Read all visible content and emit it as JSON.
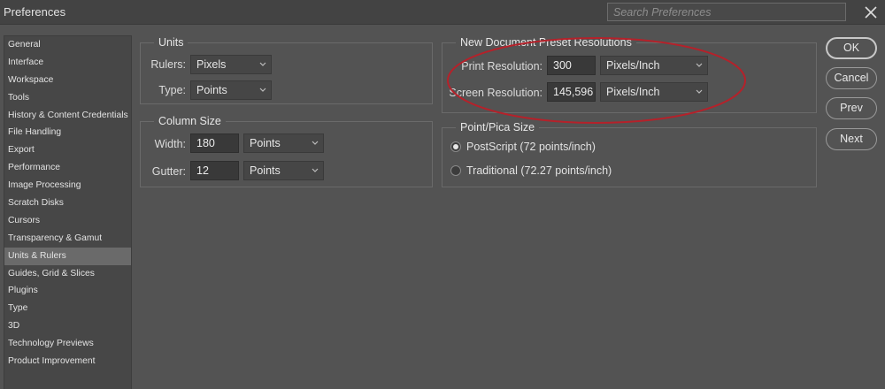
{
  "window": {
    "title": "Preferences",
    "search_placeholder": "Search Preferences"
  },
  "sidebar": {
    "items": [
      "General",
      "Interface",
      "Workspace",
      "Tools",
      "History & Content Credentials",
      "File Handling",
      "Export",
      "Performance",
      "Image Processing",
      "Scratch Disks",
      "Cursors",
      "Transparency & Gamut",
      "Units & Rulers",
      "Guides, Grid & Slices",
      "Plugins",
      "Type",
      "3D",
      "Technology Previews",
      "Product Improvement"
    ],
    "selected": "Units & Rulers"
  },
  "units": {
    "title": "Units",
    "rulers_label": "Rulers:",
    "rulers_value": "Pixels",
    "type_label": "Type:",
    "type_value": "Points"
  },
  "column_size": {
    "title": "Column Size",
    "width_label": "Width:",
    "width_value": "180",
    "width_unit": "Points",
    "gutter_label": "Gutter:",
    "gutter_value": "12",
    "gutter_unit": "Points"
  },
  "new_doc": {
    "title": "New Document Preset Resolutions",
    "print_label": "Print Resolution:",
    "print_value": "300",
    "print_unit": "Pixels/Inch",
    "screen_label": "Screen Resolution:",
    "screen_value": "145,596",
    "screen_unit": "Pixels/Inch"
  },
  "point_pica": {
    "title": "Point/Pica Size",
    "postscript_label": "PostScript (72 points/inch)",
    "traditional_label": "Traditional (72.27 points/inch)",
    "selected": "postscript"
  },
  "buttons": {
    "ok": "OK",
    "cancel": "Cancel",
    "prev": "Prev",
    "next": "Next"
  },
  "colors": {
    "annotation": "#b5212a",
    "background": "#535353",
    "sidebar_selected": "#6a6a6a"
  }
}
